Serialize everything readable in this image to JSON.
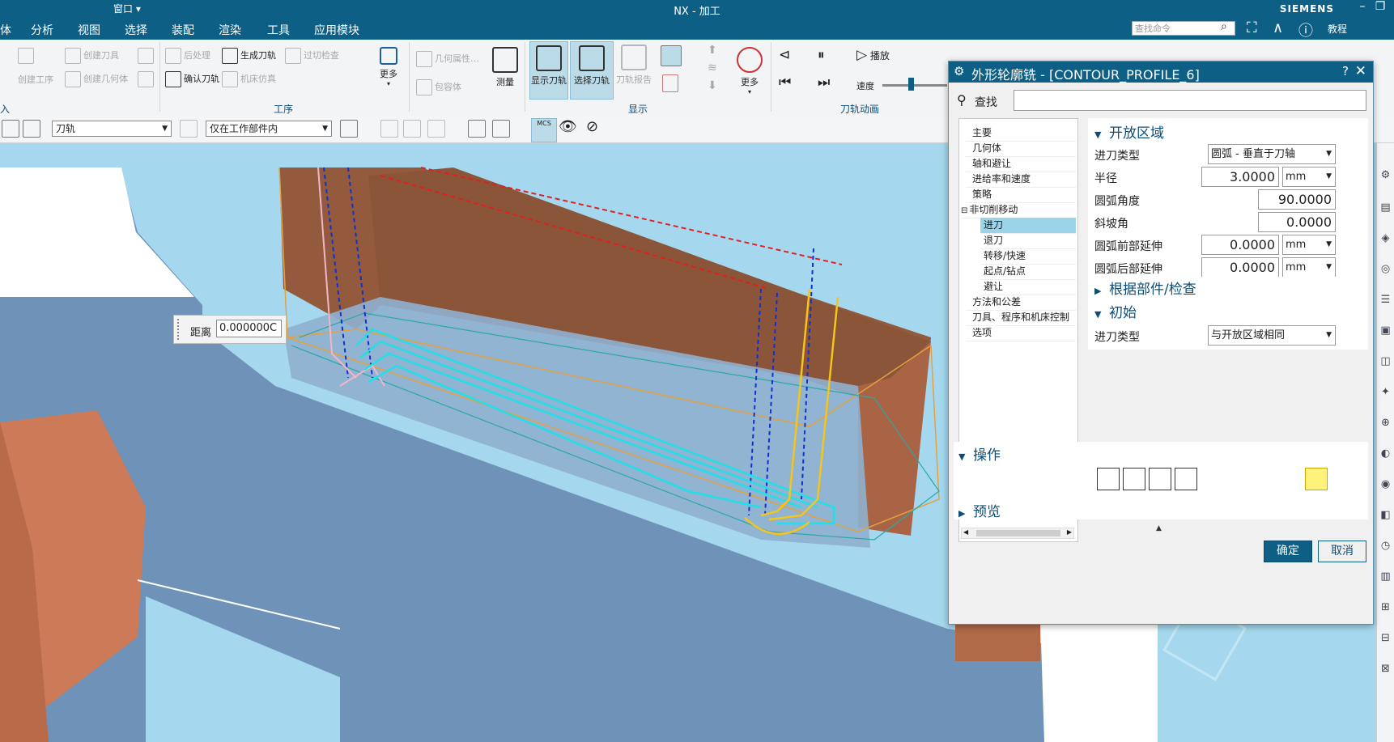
{
  "window": {
    "title": "NX - 加工",
    "brand": "SIEMENS",
    "quick_access": "窗口 ▾",
    "help_label": "教程"
  },
  "menu": [
    "体",
    "分析",
    "视图",
    "选择",
    "装配",
    "渲染",
    "工具",
    "应用模块"
  ],
  "search": {
    "placeholder": "查找命令"
  },
  "ribbon": {
    "create_op": "创建工序",
    "create_tool": "创建刀具",
    "create_geom": "创建几何体",
    "post_process": "后处理",
    "generate_path": "生成刀轨",
    "overcut_check": "过切检查",
    "verify_path": "确认刀轨",
    "machine_sim": "机床仿真",
    "more1": "更多",
    "geom_props": "几何属性…",
    "envelope": "包容体",
    "measure": "测量",
    "show_path": "显示刀轨",
    "select_path": "选择刀轨",
    "path_report": "刀轨报告",
    "more2": "更多",
    "play": "播放",
    "speed": "速度",
    "groups": {
      "insert": "入",
      "process": "工序",
      "display": "显示",
      "animation": "刀轨动画"
    }
  },
  "toolbar": {
    "filter_value": "刀轨",
    "scope_value": "仅在工作部件内",
    "mcs": "MCS"
  },
  "distance": {
    "label": "距离",
    "value": "0.000000C"
  },
  "dialog": {
    "title": "外形轮廓铣 - [CONTOUR_PROFILE_6]",
    "find_label": "查找",
    "tree": [
      {
        "label": "主要",
        "indent": 0
      },
      {
        "label": "几何体",
        "indent": 0
      },
      {
        "label": "轴和避让",
        "indent": 0
      },
      {
        "label": "进给率和速度",
        "indent": 0
      },
      {
        "label": "策略",
        "indent": 0
      },
      {
        "label": "非切削移动",
        "indent": 0
      },
      {
        "label": "进刀",
        "indent": 1,
        "selected": true
      },
      {
        "label": "退刀",
        "indent": 1
      },
      {
        "label": "转移/快速",
        "indent": 1
      },
      {
        "label": "起点/钻点",
        "indent": 1
      },
      {
        "label": "避让",
        "indent": 1
      },
      {
        "label": "方法和公差",
        "indent": 0
      },
      {
        "label": "刀具、程序和机床控制",
        "indent": 0
      },
      {
        "label": "选项",
        "indent": 0
      }
    ],
    "open_area": {
      "title": "开放区域",
      "engage_type_label": "进刀类型",
      "engage_type_value": "圆弧 - 垂直于刀轴",
      "radius_label": "半径",
      "radius_value": "3.0000",
      "radius_unit": "mm",
      "arc_angle_label": "圆弧角度",
      "arc_angle_value": "90.0000",
      "ramp_label": "斜坡角",
      "ramp_value": "0.0000",
      "arc_front_label": "圆弧前部延伸",
      "arc_front_value": "0.0000",
      "arc_front_unit": "mm",
      "arc_back_label": "圆弧后部延伸",
      "arc_back_value": "0.0000",
      "arc_back_unit": "mm"
    },
    "part_check": {
      "title": "根据部件/检查"
    },
    "initial": {
      "title": "初始",
      "engage_type_label": "进刀类型",
      "engage_type_value": "与开放区域相同"
    },
    "operations": {
      "title": "操作"
    },
    "preview": {
      "title": "预览"
    },
    "ok": "确定",
    "cancel": "取消"
  }
}
